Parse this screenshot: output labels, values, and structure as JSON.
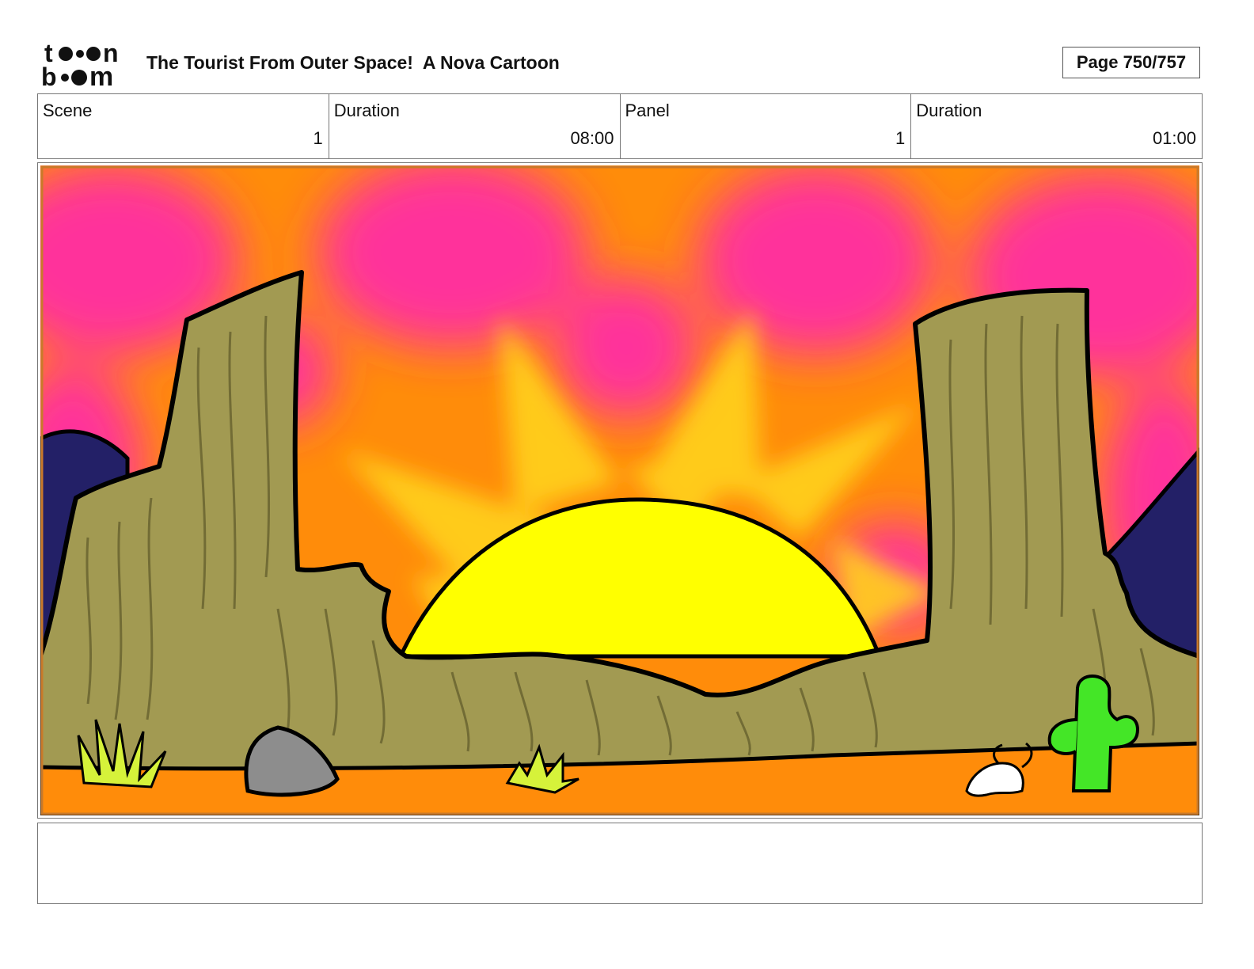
{
  "header": {
    "logo_text": "toon boom",
    "title": "The Tourist From Outer Space!  A Nova Cartoon",
    "page_label": "Page 750/757"
  },
  "info_fields": [
    {
      "label": "Scene",
      "value": "1"
    },
    {
      "label": "Duration",
      "value": "08:00"
    },
    {
      "label": "Panel",
      "value": "1"
    },
    {
      "label": "Duration",
      "value": "01:00"
    }
  ],
  "panel": {
    "colors": {
      "sky_orange": "#ff8c0a",
      "sky_pink": "#ff2fa3",
      "sun": "#ffff00",
      "sun_rays": "#ffd21a",
      "mesa": "#a29a52",
      "mountains": "#232067",
      "ground": "#ff8c0a",
      "rock": "#8d8d8d",
      "cactus": "#44e627",
      "grass": "#d6f23a"
    },
    "icons": [
      "sun-icon",
      "mesa-icon",
      "rock-icon",
      "cactus-icon",
      "skull-icon",
      "grass-icon"
    ]
  },
  "notes": {
    "text": ""
  }
}
